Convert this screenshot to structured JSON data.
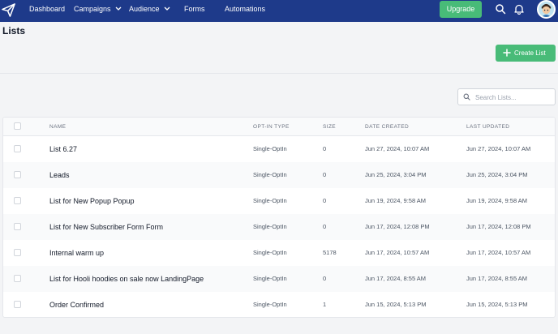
{
  "nav": {
    "items": [
      {
        "label": "Dashboard",
        "has_dropdown": false
      },
      {
        "label": "Campaigns",
        "has_dropdown": true
      },
      {
        "label": "Audience",
        "has_dropdown": true
      },
      {
        "label": "Forms",
        "has_dropdown": false
      },
      {
        "label": "Automations",
        "has_dropdown": false
      }
    ],
    "upgrade_label": "Upgrade",
    "bar_color": "#1e3a8a",
    "accent_color": "#48bb78"
  },
  "page": {
    "title": "Lists",
    "create_label": "Create List"
  },
  "search": {
    "placeholder": "Search Lists...",
    "value": ""
  },
  "table": {
    "columns": [
      "NAME",
      "OPT-IN TYPE",
      "SIZE",
      "DATE CREATED",
      "LAST UPDATED"
    ],
    "rows": [
      {
        "name": "List 6.27",
        "optin": "Single-OptIn",
        "size": "0",
        "created": "Jun 27, 2024, 10:07 AM",
        "updated": "Jun 27, 2024, 10:07 AM"
      },
      {
        "name": "Leads",
        "optin": "Single-OptIn",
        "size": "0",
        "created": "Jun 25, 2024, 3:04 PM",
        "updated": "Jun 25, 2024, 3:04 PM"
      },
      {
        "name": "List for New Popup Popup",
        "optin": "Single-OptIn",
        "size": "0",
        "created": "Jun 19, 2024, 9:58 AM",
        "updated": "Jun 19, 2024, 9:58 AM"
      },
      {
        "name": "List for New Subscriber Form Form",
        "optin": "Single-OptIn",
        "size": "0",
        "created": "Jun 17, 2024, 12:08 PM",
        "updated": "Jun 17, 2024, 12:08 PM"
      },
      {
        "name": "Internal warm up",
        "optin": "Single-OptIn",
        "size": "5178",
        "created": "Jun 17, 2024, 10:57 AM",
        "updated": "Jun 17, 2024, 10:57 AM"
      },
      {
        "name": "List for Hooli hoodies on sale now LandingPage",
        "optin": "Single-OptIn",
        "size": "0",
        "created": "Jun 17, 2024, 8:55 AM",
        "updated": "Jun 17, 2024, 8:55 AM"
      },
      {
        "name": "Order Confirmed",
        "optin": "Single-OptIn",
        "size": "1",
        "created": "Jun 15, 2024, 5:13 PM",
        "updated": "Jun 15, 2024, 5:13 PM"
      }
    ]
  }
}
